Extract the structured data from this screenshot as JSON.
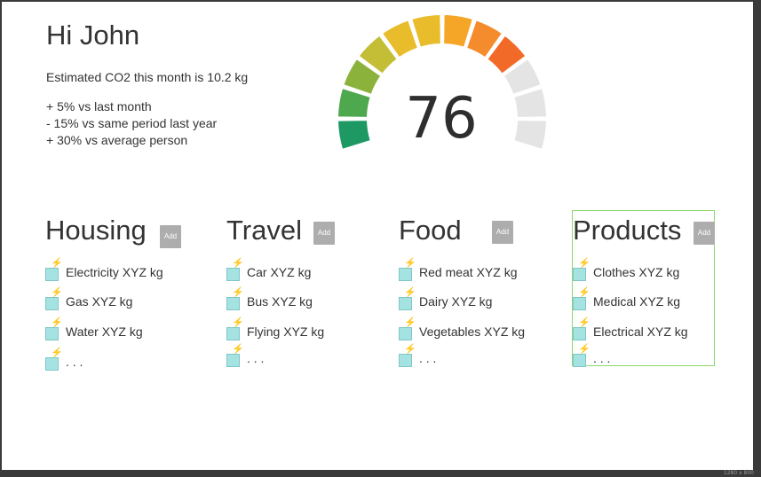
{
  "greeting": "Hi John",
  "summary": "Estimated CO2 this month is 10.2 kg",
  "comparisons": [
    "+ 5% vs last month",
    "- 15% vs same period last year",
    "+ 30% vs average person"
  ],
  "gauge": {
    "value": "76",
    "segments_total": 12,
    "segments_filled": 9,
    "colors": [
      "#1e9963",
      "#4ea84e",
      "#8bb33c",
      "#c3be35",
      "#e8bc2b",
      "#f6a627",
      "#f48b2c",
      "#f26a27"
    ],
    "empty_color": "#e4e4e4"
  },
  "categories": [
    {
      "title": "Housing",
      "add_label": "Add",
      "items": [
        {
          "label": "Electricity XYZ kg"
        },
        {
          "label": "Gas XYZ kg"
        },
        {
          "label": "Water XYZ kg"
        },
        {
          "label": ". . ."
        }
      ]
    },
    {
      "title": "Travel",
      "add_label": "Add",
      "items": [
        {
          "label": " Car XYZ kg"
        },
        {
          "label": "Bus  XYZ kg"
        },
        {
          "label": " Flying XYZ kg"
        },
        {
          "label": ". . ."
        }
      ]
    },
    {
      "title": "Food",
      "add_label": "Add",
      "items": [
        {
          "label": " Red meat XYZ kg"
        },
        {
          "label": "Dairy XYZ kg"
        },
        {
          "label": "Vegetables XYZ kg"
        },
        {
          "label": ". . ."
        }
      ]
    },
    {
      "title": "Products",
      "add_label": "Add",
      "items": [
        {
          "label": "  Clothes XYZ kg"
        },
        {
          "label": "Medical XYZ kg"
        },
        {
          "label": "Electrical XYZ kg"
        },
        {
          "label": ". . ."
        }
      ]
    }
  ],
  "canvas_size_label": "1280 x 800",
  "icons": {
    "item": "lightning-bolt-icon",
    "check": "checkbox"
  }
}
